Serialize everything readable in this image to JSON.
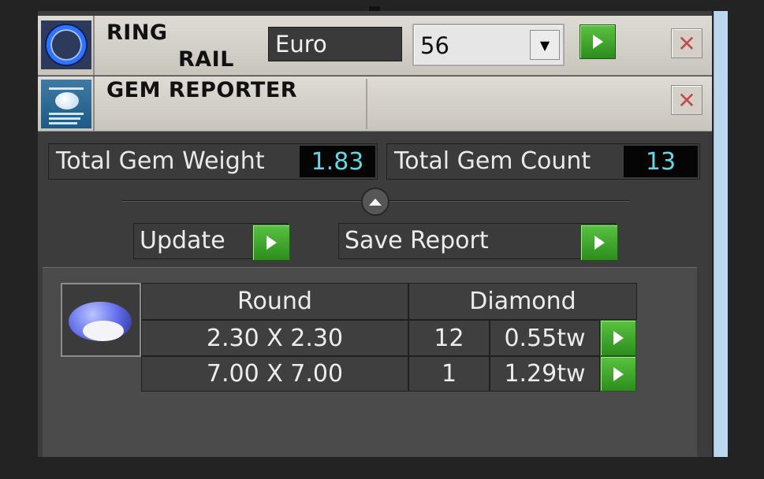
{
  "ring_rail": {
    "title_line1": "RING",
    "title_line2": "RAIL",
    "currency": "Euro",
    "size_select": {
      "value": "56",
      "options_visible": [
        "56"
      ]
    }
  },
  "gem_reporter": {
    "title": "GEM REPORTER"
  },
  "stats": {
    "weight_label": "Total Gem Weight",
    "weight_value": "1.83",
    "count_label": "Total Gem Count",
    "count_value": "13"
  },
  "actions": {
    "update_label": "Update",
    "save_label": "Save Report"
  },
  "gem_table": {
    "headers": [
      "Round",
      "Diamond"
    ],
    "rows": [
      {
        "size": "2.30 X 2.30",
        "count": "12",
        "weight": "0.55tw"
      },
      {
        "size": "7.00 X 7.00",
        "count": "1",
        "weight": "1.29tw"
      }
    ]
  },
  "colors": {
    "accent_green": "#3aa12a",
    "value_cyan": "#66d7e2",
    "panel_dark": "#3c3c3c",
    "scrollbar_blue": "#bcd6ee"
  },
  "icons": [
    "ring-icon",
    "gem-reporter-icon",
    "play-icon",
    "close-icon",
    "chevron-down-icon",
    "collapse-up-icon",
    "round-gem-icon"
  ]
}
